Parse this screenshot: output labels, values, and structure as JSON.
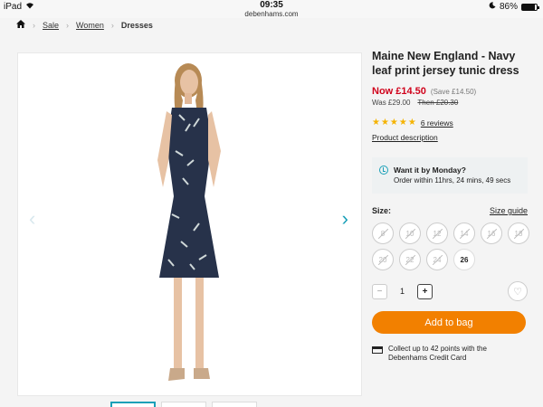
{
  "status_bar": {
    "device": "iPad",
    "time": "09:35",
    "url": "debenhams.com",
    "battery": "86%",
    "battery_level": 0.86
  },
  "breadcrumb": {
    "items": [
      "Sale",
      "Women"
    ],
    "current": "Dresses"
  },
  "product": {
    "title": "Maine New England - Navy leaf print jersey tunic dress",
    "now_price": "Now £14.50",
    "save": "(Save £14.50)",
    "was_price": "Was £29.00",
    "then_price": "Then £20.30",
    "rating": 5,
    "reviews_link": "6 reviews",
    "description_link": "Product description"
  },
  "delivery": {
    "heading": "Want it by Monday?",
    "detail": "Order within 11hrs, 24 mins, 49 secs"
  },
  "size": {
    "label": "Size:",
    "guide_link": "Size guide",
    "options": [
      {
        "label": "8",
        "available": false
      },
      {
        "label": "10",
        "available": false
      },
      {
        "label": "12",
        "available": false
      },
      {
        "label": "14",
        "available": false
      },
      {
        "label": "16",
        "available": false
      },
      {
        "label": "18",
        "available": false
      },
      {
        "label": "20",
        "available": false
      },
      {
        "label": "22",
        "available": false
      },
      {
        "label": "24",
        "available": false
      },
      {
        "label": "26",
        "available": true
      }
    ]
  },
  "quantity": {
    "minus": "−",
    "value": "1",
    "plus": "+"
  },
  "add_to_bag": "Add to bag",
  "points_text": "Collect up to 42 points with the Debenhams Credit Card",
  "colors": {
    "accent": "#1aa0b8",
    "price_red": "#d0021b",
    "cta_orange": "#f28000",
    "star": "#f5b301"
  }
}
